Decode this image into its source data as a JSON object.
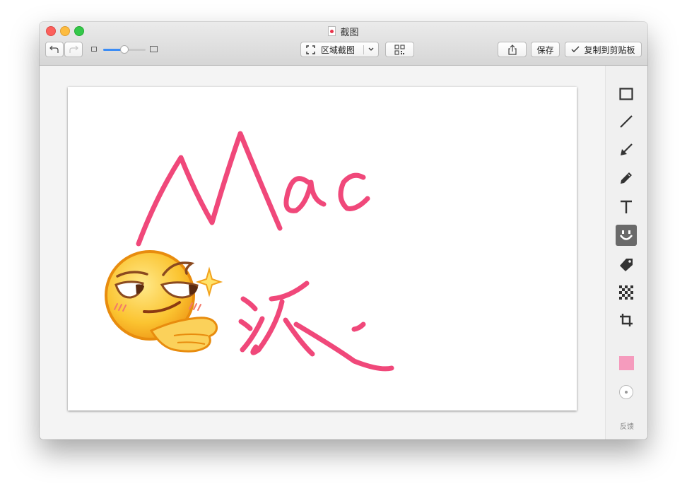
{
  "window": {
    "title": "截图"
  },
  "toolbar": {
    "capture_mode_label": "区域截图",
    "save_label": "保存",
    "copy_label": "复制到剪贴板",
    "zoom_level": 0.5
  },
  "sidebar": {
    "tools": [
      {
        "name": "rectangle-tool",
        "icon": "rectangle-icon",
        "active": false
      },
      {
        "name": "line-tool",
        "icon": "line-icon",
        "active": false
      },
      {
        "name": "arrow-tool",
        "icon": "arrow-icon",
        "active": false
      },
      {
        "name": "pen-tool",
        "icon": "pencil-icon",
        "active": false
      },
      {
        "name": "text-tool",
        "icon": "text-icon",
        "active": false
      },
      {
        "name": "emoji-tool",
        "icon": "smiley-icon",
        "active": true
      },
      {
        "name": "tag-tool",
        "icon": "tag-icon",
        "active": false
      },
      {
        "name": "mosaic-tool",
        "icon": "mosaic-icon",
        "active": false
      },
      {
        "name": "crop-tool",
        "icon": "crop-icon",
        "active": false
      }
    ],
    "color": "#f59bbd",
    "feedback_label": "反馈"
  },
  "canvas": {
    "stroke_color": "#f0487a",
    "handwriting_text": "Mac派",
    "emoji": "smirking-thumbs-emoji"
  }
}
